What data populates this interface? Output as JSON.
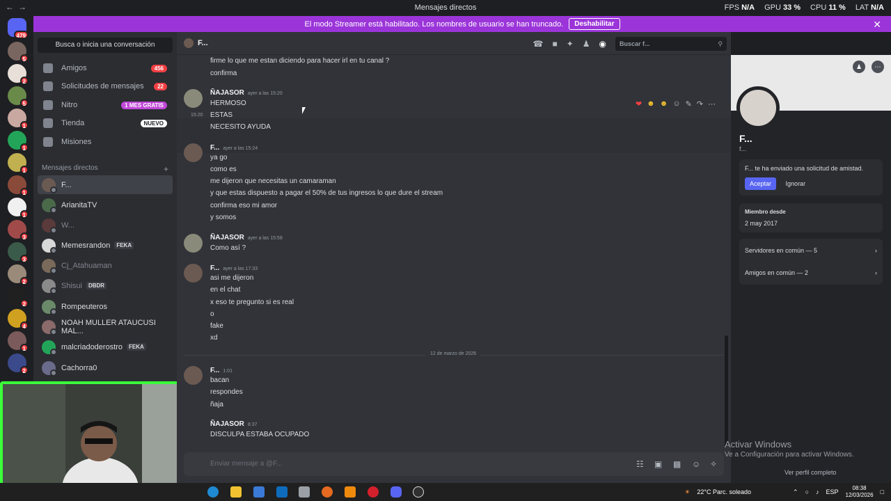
{
  "titlebar": {
    "title": "Mensajes directos",
    "stats": [
      {
        "label": "FPS",
        "value": "N/A"
      },
      {
        "label": "GPU",
        "value": "33 %"
      },
      {
        "label": "CPU",
        "value": "11 %"
      },
      {
        "label": "LAT",
        "value": "N/A"
      }
    ]
  },
  "banner": {
    "text": "El modo Streamer está habilitado. Los nombres de usuario se han truncado.",
    "button": "Deshabilitar"
  },
  "guilds": {
    "home_badge": "479",
    "badges": [
      "5",
      "2",
      "5",
      "1",
      "1",
      "1",
      "1",
      "1",
      "3",
      "3",
      "2",
      "2",
      "4",
      "1",
      "2"
    ]
  },
  "sidebar": {
    "search": "Busca o inicia una conversación",
    "nav": [
      {
        "label": "Amigos",
        "badge": "456",
        "icon": "friends-icon"
      },
      {
        "label": "Solicitudes de mensajes",
        "badge": "22",
        "icon": "envelope-icon"
      },
      {
        "label": "Nitro",
        "badge": "1 MES GRATIS",
        "icon": "nitro-icon"
      },
      {
        "label": "Tienda",
        "badge": "NUEVO",
        "icon": "shop-icon"
      },
      {
        "label": "Misiones",
        "badge": "",
        "icon": "quest-icon"
      }
    ],
    "dm_header": "Mensajes directos",
    "dm_add": "+",
    "dms": [
      {
        "name": "F...",
        "tag": "",
        "color": "#6b5a52"
      },
      {
        "name": "ArianitaTV",
        "tag": "",
        "color": "#4a6a4a"
      },
      {
        "name": "W...",
        "tag": "",
        "color": "#5a3a3a"
      },
      {
        "name": "Memesrandon",
        "tag": "FEKA",
        "color": "#d8d8d8"
      },
      {
        "name": "Cj_Atahuaman",
        "tag": "",
        "color": "#7a6a5a"
      },
      {
        "name": "Shisui",
        "tag": "DBDR",
        "color": "#8a8a8a"
      },
      {
        "name": "Rompeuteros",
        "tag": "",
        "color": "#6a8a6a"
      },
      {
        "name": "NOAH MULLER ATAUCUSI MAL...",
        "tag": "",
        "color": "#8a6a6a"
      },
      {
        "name": "malcriadoderostro",
        "tag": "FEKA",
        "color": "#23a559"
      },
      {
        "name": "Cachorra0",
        "tag": "",
        "color": "#6a6a8a"
      }
    ]
  },
  "chat": {
    "header_name": "F...",
    "search_placeholder": "Buscar f...",
    "top_lines": [
      "firme lo que me estan diciendo para hacer irl  en tu canal ?",
      "confirma"
    ],
    "groups": [
      {
        "author": "ÑAJASOR",
        "time": "ayer a las 15:20",
        "lines": [
          "HERMOSO",
          "ESTAS",
          "NECESITO AYUDA"
        ],
        "hover_time": "15:20"
      },
      {
        "author": "F...",
        "time": "ayer a las 15:24",
        "lines": [
          "ya go",
          "como es",
          "me dijeron que necesitas un camaraman",
          "y que estas dispuesto a pagar el 50% de tus ingresos    lo que dure el stream",
          "confirma eso mi amor",
          "y somos"
        ]
      },
      {
        "author": "ÑAJASOR",
        "time": "ayer a las 15:58",
        "lines": [
          "Como así ?"
        ]
      },
      {
        "author": "F...",
        "time": "ayer a las 17:33",
        "lines": [
          "asi me dijeron",
          "en el chat",
          "x eso te pregunto  si es real",
          "o",
          "fake",
          "xd"
        ]
      },
      {
        "author": "F...",
        "time": "1:01",
        "lines": [
          "bacan",
          "respondes",
          "ñaja"
        ]
      },
      {
        "author": "ÑAJASOR",
        "time": "8:37",
        "lines": [
          "DISCULPA ESTABA OCUPADO"
        ]
      }
    ],
    "day_separator": "12 de marzo de 2026",
    "composer_placeholder": "Enviar mensaje a @F..."
  },
  "profile": {
    "name": "F...",
    "username": "f...",
    "request_text": "F... te ha enviado una solicitud de amistad.",
    "accept": "Aceptar",
    "ignore": "Ignorar",
    "member_since_label": "Miembro desde",
    "member_since": "2 may 2017",
    "servers": "Servidores en común — 5",
    "friends": "Amigos en común — 2",
    "full_profile": "Ver perfil completo"
  },
  "watermark": {
    "line1": "Activar Windows",
    "line2": "Ve a Configuración para activar Windows."
  },
  "taskbar": {
    "weather": "22°C  Parc. soleado",
    "lang": "ESP",
    "time": "08:38",
    "date": "12/03/2026"
  }
}
